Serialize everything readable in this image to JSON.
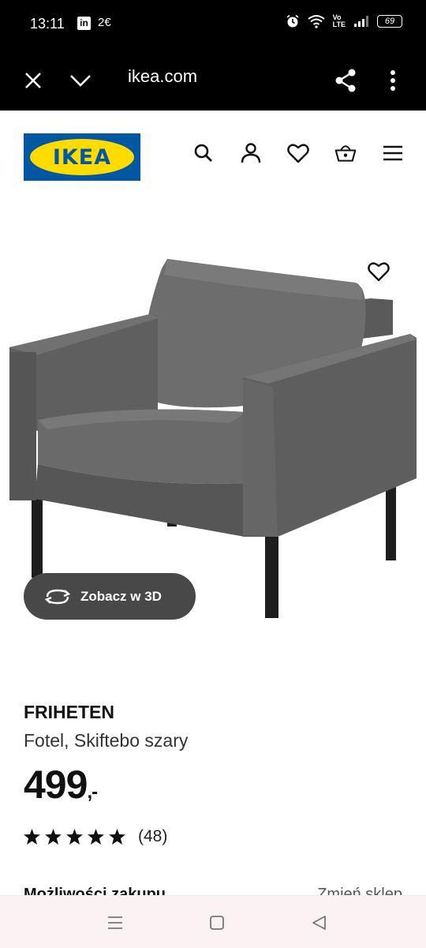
{
  "status_bar": {
    "time": "13:11",
    "linkedin": "in",
    "misc": "2€",
    "network": "Vo LTE",
    "battery": "69"
  },
  "browser": {
    "url": "ikea.com",
    "icons": [
      "close-icon",
      "chevron-down-icon",
      "share-icon",
      "more-vertical-icon"
    ]
  },
  "header": {
    "logo_text": "IKEA",
    "icons": [
      "search-icon",
      "user-icon",
      "heart-icon",
      "basket-icon",
      "menu-icon"
    ],
    "brand_colors": {
      "blue": "#0058a3",
      "yellow": "#ffdb00"
    }
  },
  "product": {
    "name": "FRIHETEN",
    "description": "Fotel, Skiftebo szary",
    "price": "499",
    "price_suffix": ",-",
    "rating": 5,
    "review_count": "(48)",
    "view_3d_label": "Zobacz w 3D"
  },
  "purchase": {
    "title": "Możliwości zakupu",
    "change_store": "Zmień sklep"
  },
  "nav_bar": {
    "icons": [
      "recents-icon",
      "home-icon",
      "back-icon"
    ]
  }
}
